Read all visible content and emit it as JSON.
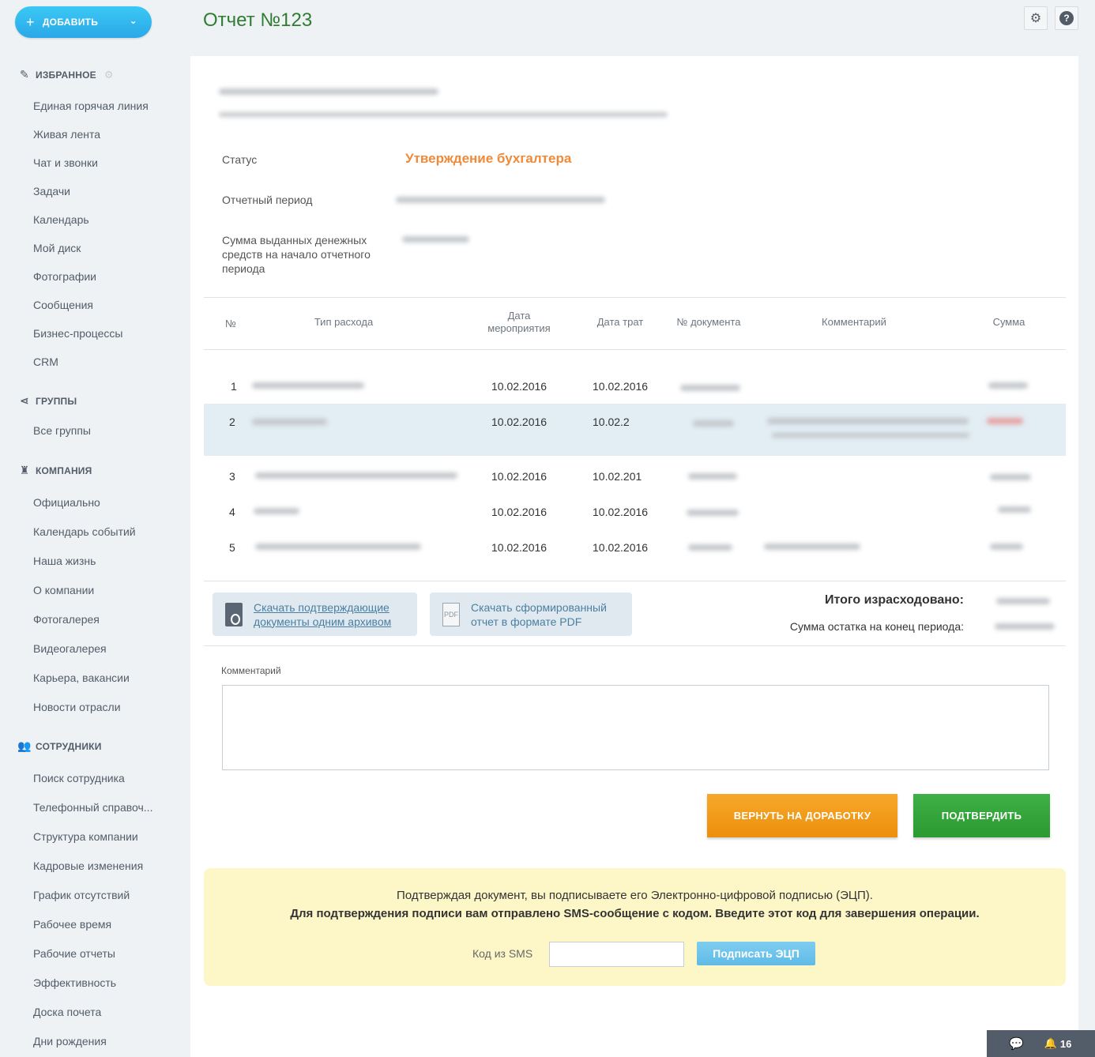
{
  "sidebar": {
    "add_button": "ДОБАВИТЬ",
    "favorites": {
      "title": "ИЗБРАННОЕ",
      "items": [
        "Единая горячая линия",
        "Живая лента",
        "Чат и звонки",
        "Задачи",
        "Календарь",
        "Мой диск",
        "Фотографии",
        "Сообщения",
        "Бизнес-процессы",
        "CRM"
      ]
    },
    "groups": {
      "title": "ГРУППЫ",
      "items": [
        "Все группы"
      ]
    },
    "company": {
      "title": "КОМПАНИЯ",
      "items": [
        "Официально",
        "Календарь событий",
        "Наша жизнь",
        "О компании",
        "Фотогалерея",
        "Видеогалерея",
        "Карьера, вакансии",
        "Новости отрасли"
      ]
    },
    "employees": {
      "title": "СОТРУДНИКИ",
      "items": [
        "Поиск сотрудника",
        "Телефонный справоч...",
        "Структура компании",
        "Кадровые изменения",
        "График отсутствий",
        "Рабочее время",
        "Рабочие отчеты",
        "Эффективность",
        "Доска почета",
        "Дни рождения"
      ]
    }
  },
  "header": {
    "title": "Отчет №123"
  },
  "details": {
    "status_label": "Статус",
    "status_value": "Утверждение бухгалтера",
    "period_label": "Отчетный период",
    "sum_label_1": "Сумма выданных денежных",
    "sum_label_2": "средств на начало отчетного",
    "sum_label_3": "периода"
  },
  "table": {
    "headers": {
      "num": "№",
      "type": "Тип расхода",
      "event_date_1": "Дата",
      "event_date_2": "мероприятия",
      "spend_date": "Дата трат",
      "doc_num": "№ документа",
      "comment": "Комментарий",
      "sum": "Сумма"
    },
    "rows": [
      {
        "num": "1",
        "event_date": "10.02.2016",
        "spend_date": "10.02.2016"
      },
      {
        "num": "2",
        "event_date": "10.02.2016",
        "spend_date": "10.02.2"
      },
      {
        "num": "3",
        "event_date": "10.02.2016",
        "spend_date": "10.02.201"
      },
      {
        "num": "4",
        "event_date": "10.02.2016",
        "spend_date": "10.02.2016"
      },
      {
        "num": "5",
        "event_date": "10.02.2016",
        "spend_date": "10.02.2016"
      }
    ]
  },
  "downloads": {
    "archive_1": "Скачать подтверждающие",
    "archive_2": "документы одним архивом",
    "pdf_1": "Скачать сформированный",
    "pdf_2": "отчет в формате PDF",
    "pdf_icon": "PDF"
  },
  "totals": {
    "spent_label": "Итого израсходовано:",
    "remain_label": "Сумма остатка на конец периода:"
  },
  "comment": {
    "label": "Комментарий",
    "value": ""
  },
  "actions": {
    "return": "ВЕРНУТЬ НА ДОРАБОТКУ",
    "confirm": "ПОДТВЕРДИТЬ"
  },
  "sms": {
    "note": "Подтверждая документ, вы подписываете его Электронно-цифровой подписью (ЭЦП).",
    "note_bold": "Для подтверждения подписи вам отправлено SMS-сообщение с кодом. Введите этот код для завершения операции.",
    "code_label": "Код из SMS",
    "code_value": "",
    "sign_button": "Подписать ЭЦП"
  },
  "bottom_bar": {
    "notifications": "16"
  },
  "icons": {
    "plus": "plus-icon",
    "chevron": "chevron-down-icon",
    "favorites": "pin-icon",
    "groups": "share-icon",
    "company": "tower-icon",
    "employees": "people-icon",
    "settings": "gear-icon",
    "help": "help-icon",
    "chat": "chat-icon",
    "bell": "bell-icon",
    "zip": "zip-file-icon",
    "pdf": "pdf-file-icon"
  },
  "colors": {
    "accent": "#2aa8e8",
    "title": "#2f7d32",
    "status": "#ef8a3a",
    "return": "#ec8f0c",
    "confirm": "#2a9a31",
    "sms_panel": "#fdf7c8"
  }
}
